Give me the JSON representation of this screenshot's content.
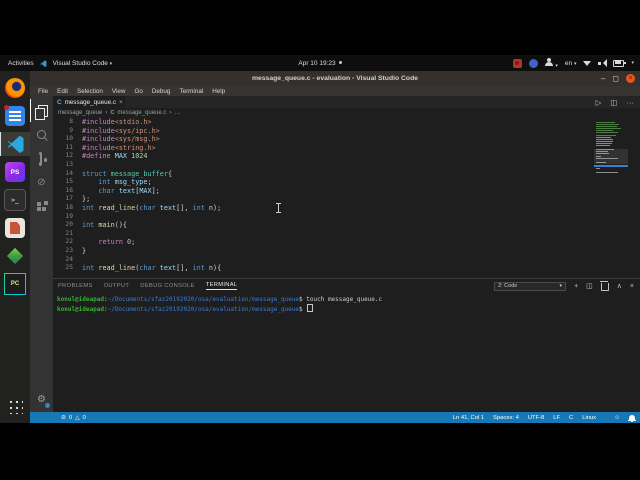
{
  "top_bar": {
    "activities": "Activities",
    "focused_app": "Visual Studio Code",
    "clock": "Apr 10 19:23",
    "input_language": "en"
  },
  "dock": {
    "items": [
      {
        "id": "firefox",
        "label": ""
      },
      {
        "id": "files",
        "label": ""
      },
      {
        "id": "vscode",
        "label": "",
        "active": true
      },
      {
        "id": "phpstorm",
        "label": "PS"
      },
      {
        "id": "terminal-app",
        "label": ">_"
      },
      {
        "id": "libreoffice",
        "label": ""
      },
      {
        "id": "boxes",
        "label": ""
      },
      {
        "id": "pycharm",
        "label": "PC"
      }
    ]
  },
  "window": {
    "title": "message_queue.c - evaluation - Visual Studio Code",
    "controls": {
      "minimize": "–",
      "maximize": "◻",
      "close": "×"
    },
    "menu_items": [
      "File",
      "Edit",
      "Selection",
      "View",
      "Go",
      "Debug",
      "Terminal",
      "Help"
    ]
  },
  "editor": {
    "tab": {
      "icon": "C",
      "label": "message_queue.c",
      "close": "×"
    },
    "breadcrumb": {
      "folder": "message_queue",
      "sep": "›",
      "file_icon": "C",
      "file": "message_queue.c",
      "more": "…"
    },
    "actions": {
      "run": "▷",
      "split": "◫",
      "more": "···"
    },
    "colors": {
      "pp": "#C586C0",
      "str": "#CE9178",
      "kw": "#569CD6",
      "type": "#4EC9B0",
      "var": "#9CDCFE",
      "fn": "#DCDCAA",
      "num": "#B5CEA8",
      "pun": "#D4D4D4",
      "def": "#9CDCFE"
    },
    "lines": [
      {
        "n": "8",
        "t": [
          [
            "pp",
            "#include"
          ],
          [
            "str",
            "<stdio.h>"
          ]
        ]
      },
      {
        "n": "9",
        "t": [
          [
            "pp",
            "#include"
          ],
          [
            "str",
            "<sys/ipc.h>"
          ]
        ]
      },
      {
        "n": "10",
        "t": [
          [
            "pp",
            "#include"
          ],
          [
            "str",
            "<sys/msg.h>"
          ]
        ]
      },
      {
        "n": "11",
        "t": [
          [
            "pp",
            "#include"
          ],
          [
            "str",
            "<string.h>"
          ]
        ]
      },
      {
        "n": "12",
        "t": [
          [
            "pp",
            "#define"
          ],
          [
            "def",
            " MAX"
          ],
          [
            "num",
            " 1024"
          ]
        ]
      },
      {
        "n": "13",
        "t": []
      },
      {
        "n": "14",
        "t": [
          [
            "kw",
            "struct"
          ],
          [
            "type",
            " message_buffer"
          ],
          [
            "pun",
            "{"
          ]
        ]
      },
      {
        "n": "15",
        "t": [
          [
            "kw",
            "    int"
          ],
          [
            "var",
            " msg_type"
          ],
          [
            "pun",
            ";"
          ]
        ]
      },
      {
        "n": "16",
        "t": [
          [
            "kw",
            "    char"
          ],
          [
            "var",
            " text"
          ],
          [
            "pun",
            "["
          ],
          [
            "def",
            "MAX"
          ],
          [
            "pun",
            "];"
          ]
        ]
      },
      {
        "n": "17",
        "t": [
          [
            "pun",
            "};"
          ]
        ]
      },
      {
        "n": "18",
        "t": [
          [
            "kw",
            "int"
          ],
          [
            "fn",
            " read_line"
          ],
          [
            "pun",
            "("
          ],
          [
            "kw",
            "char"
          ],
          [
            "var",
            " text"
          ],
          [
            "pun",
            "[], "
          ],
          [
            "kw",
            "int"
          ],
          [
            "var",
            " n"
          ],
          [
            "pun",
            ");"
          ]
        ]
      },
      {
        "n": "19",
        "t": []
      },
      {
        "n": "20",
        "t": [
          [
            "kw",
            "int"
          ],
          [
            "fn",
            " main"
          ],
          [
            "pun",
            "(){"
          ]
        ]
      },
      {
        "n": "21",
        "t": []
      },
      {
        "n": "22",
        "t": [
          [
            "pp",
            "    return"
          ],
          [
            "num",
            " 0"
          ],
          [
            "pun",
            ";"
          ]
        ]
      },
      {
        "n": "23",
        "t": [
          [
            "pun",
            "}"
          ]
        ]
      },
      {
        "n": "24",
        "t": []
      },
      {
        "n": "25",
        "t": [
          [
            "kw",
            "int"
          ],
          [
            "fn",
            " read_line"
          ],
          [
            "pun",
            "("
          ],
          [
            "kw",
            "char"
          ],
          [
            "var",
            " text"
          ],
          [
            "pun",
            "[], "
          ],
          [
            "kw",
            "int"
          ],
          [
            "var",
            " n"
          ],
          [
            "pun",
            "){"
          ]
        ]
      }
    ],
    "minimap_stripes": [
      [
        "#4e7d46",
        19
      ],
      [
        "#4e7d46",
        23
      ],
      [
        "#4e7d46",
        21
      ],
      [
        "#4e7d46",
        25
      ],
      [
        "#4e7d46",
        17
      ],
      [
        "#4e7d46",
        22
      ],
      [
        "#4e7d46",
        20
      ],
      [
        "#9a7f9a",
        15
      ],
      [
        "#9a7f9a",
        17
      ],
      [
        "#9a7f9a",
        17
      ],
      [
        "#9a7f9a",
        16
      ],
      [
        "#9a7f9a",
        14
      ],
      [
        "#555555",
        0
      ],
      [
        "#8a8a8a",
        18
      ],
      [
        "#8a8a8a",
        12
      ],
      [
        "#8a8a8a",
        13
      ],
      [
        "#8a8a8a",
        5
      ],
      [
        "#8a8a8a",
        22
      ],
      [
        "#555555",
        0
      ],
      [
        "#8a8a8a",
        10
      ],
      [
        "#555555",
        0
      ],
      [
        "#8a8a8a",
        9
      ],
      [
        "#8a8a8a",
        4
      ],
      [
        "#555555",
        0
      ],
      [
        "#8a8a8a",
        22
      ]
    ]
  },
  "panel": {
    "tabs": [
      "PROBLEMS",
      "OUTPUT",
      "DEBUG CONSOLE",
      "TERMINAL"
    ],
    "active_tab": "TERMINAL",
    "terminal_select": "2: Code",
    "select_caret": "▾",
    "actions": {
      "new": "+",
      "split": "◫",
      "up": "∧",
      "close": "×"
    },
    "term_colors": {
      "user": "#33b433",
      "path": "#3a7bd5",
      "fg": "#cccccc"
    },
    "terminal_lines": [
      {
        "t": [
          [
            "user",
            "konul@ideapad"
          ],
          [
            "fg",
            ":"
          ],
          [
            "path",
            "~/Documents/sfaz20192020/osa/evaluation/message_queue"
          ],
          [
            "fg",
            "$ touch message_queue.c"
          ]
        ],
        "cursor": false
      },
      {
        "t": [
          [
            "user",
            "konul@ideapad"
          ],
          [
            "fg",
            ":"
          ],
          [
            "path",
            "~/Documents/sfaz20192020/osa/evaluation/message_queue"
          ],
          [
            "fg",
            "$ "
          ]
        ],
        "cursor": true
      }
    ]
  },
  "status_bar": {
    "error_icon": "⊘",
    "errors": "0",
    "warning_icon": "△",
    "warnings": "0",
    "items": [
      "Ln 41, Col 1",
      "Spaces: 4",
      "UTF-8",
      "LF",
      "C",
      "Linux"
    ],
    "smiley": "☺",
    "accent": "#1678b4"
  }
}
